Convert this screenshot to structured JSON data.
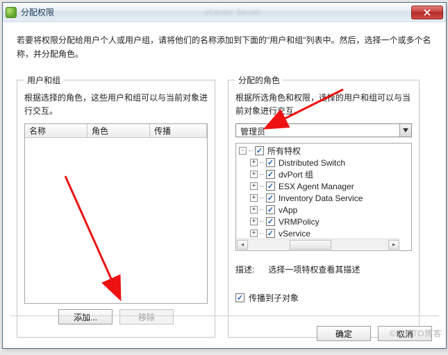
{
  "window": {
    "title": "分配权限",
    "blur_text": "vCenter Server"
  },
  "instruction": "若要将权限分配给用户个人或用户组，请将他们的名称添加到下面的\"用户和组\"列表中。然后，选择一个或多个名称，并分配角色。",
  "left": {
    "legend": "用户和组",
    "desc": "根据选择的角色，这些用户和组可以与当前对象进行交互。",
    "cols": {
      "name": "名称",
      "role": "角色",
      "prop": "传播"
    },
    "add_btn": "添加...",
    "remove_btn": "移除"
  },
  "right": {
    "legend": "分配的角色",
    "desc": "根据所选角色和权限，选择的用户和组可以与当前对象进行交互。",
    "selected_role": "管理员",
    "tree": [
      {
        "label": "所有特权",
        "depth": 0,
        "exp": "-"
      },
      {
        "label": "Distributed Switch",
        "depth": 1,
        "exp": "+"
      },
      {
        "label": "dvPort 组",
        "depth": 1,
        "exp": "+"
      },
      {
        "label": "ESX Agent Manager",
        "depth": 1,
        "exp": "+"
      },
      {
        "label": "Inventory Data Service",
        "depth": 1,
        "exp": "+"
      },
      {
        "label": "vApp",
        "depth": 1,
        "exp": "+"
      },
      {
        "label": "VRMPolicy",
        "depth": 1,
        "exp": "+"
      },
      {
        "label": "vService",
        "depth": 1,
        "exp": "+"
      }
    ],
    "desc_label": "描述:",
    "desc_value": "选择一项特权查看其描述",
    "propagate_label": "传播到子对象"
  },
  "buttons": {
    "ok": "确定",
    "cancel": "取消"
  },
  "watermark": "©51CTO博客"
}
